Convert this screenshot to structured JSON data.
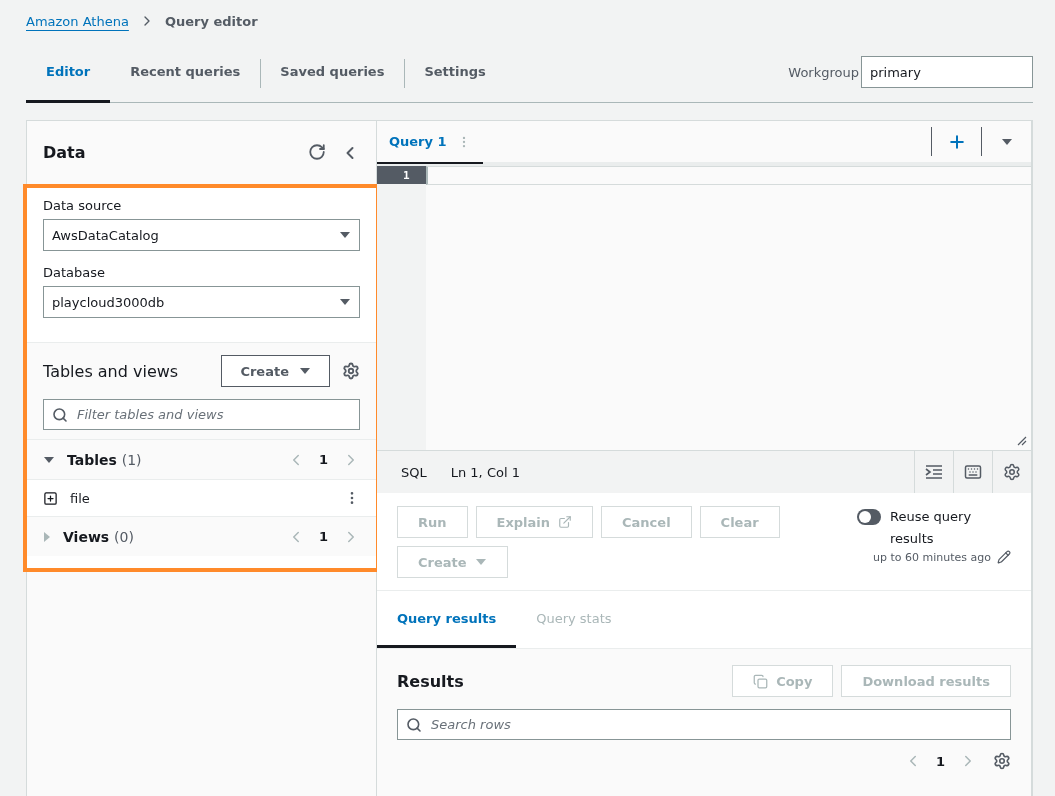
{
  "breadcrumb": {
    "link": "Amazon Athena",
    "current": "Query editor"
  },
  "tabs": [
    {
      "label": "Editor",
      "selected": true
    },
    {
      "label": "Recent queries",
      "selected": false
    },
    {
      "label": "Saved queries",
      "selected": false
    },
    {
      "label": "Settings",
      "selected": false
    }
  ],
  "workgroup": {
    "label": "Workgroup",
    "value": "primary"
  },
  "data_panel": {
    "title": "Data",
    "data_source": {
      "label": "Data source",
      "value": "AwsDataCatalog"
    },
    "database": {
      "label": "Database",
      "value": "playcloud3000db"
    },
    "tables_and_views": {
      "title": "Tables and views",
      "create_button": "Create",
      "filter": {
        "placeholder": "Filter tables and views"
      }
    },
    "sections": [
      {
        "title": "Tables",
        "count": "(1)",
        "expanded": true,
        "page": "1",
        "items": [
          {
            "name": "file"
          }
        ]
      },
      {
        "title": "Views",
        "count": "(0)",
        "expanded": false,
        "page": "1"
      }
    ]
  },
  "query_tabs": [
    {
      "label": "Query 1",
      "selected": true
    }
  ],
  "editor": {
    "line_numbers": [
      "1"
    ]
  },
  "status_bar": {
    "language": "SQL",
    "position": "Ln 1, Col 1"
  },
  "actions": [
    {
      "label": "Run",
      "disabled": true,
      "kind": "plain"
    },
    {
      "label": "Explain",
      "disabled": true,
      "kind": "external"
    },
    {
      "label": "Cancel",
      "disabled": true,
      "kind": "plain"
    },
    {
      "label": "Clear",
      "disabled": true,
      "kind": "plain"
    },
    {
      "label": "Create",
      "disabled": true,
      "kind": "dropdown"
    }
  ],
  "reuse": {
    "label": "Reuse query results",
    "on": false,
    "note": "up to 60 minutes ago"
  },
  "results_tabs": [
    {
      "label": "Query results",
      "selected": true
    },
    {
      "label": "Query stats",
      "selected": false
    }
  ],
  "results": {
    "title": "Results",
    "copy_button": "Copy",
    "download_button": "Download results",
    "search": {
      "placeholder": "Search rows"
    },
    "page": "1"
  }
}
